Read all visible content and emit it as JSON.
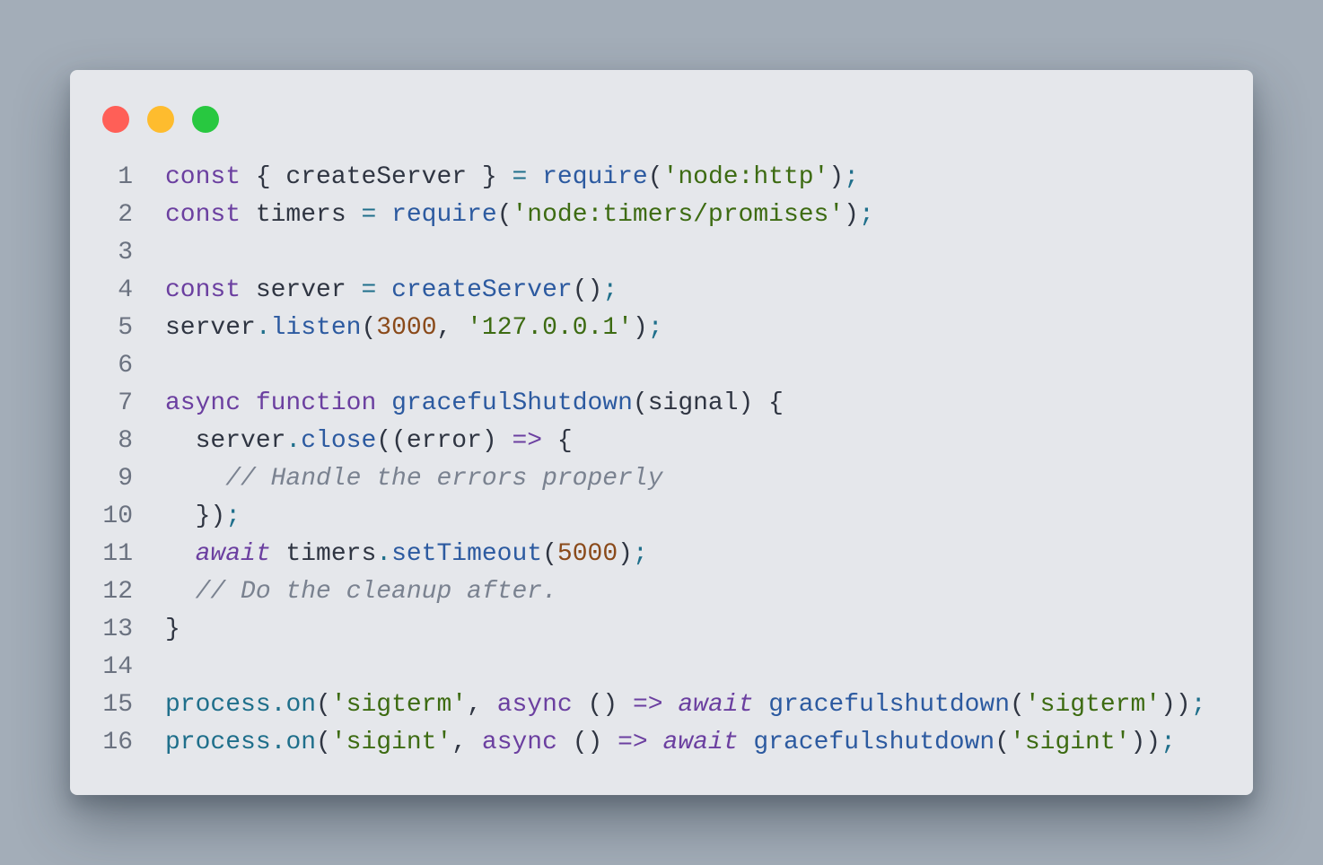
{
  "window": {
    "controls": [
      "close",
      "minimize",
      "maximize"
    ],
    "colors": {
      "close": "#ff5f57",
      "minimize": "#febc2e",
      "maximize": "#28c840",
      "background": "#e5e7eb",
      "page": "#a3adb8"
    }
  },
  "editor": {
    "language": "javascript",
    "lines": [
      {
        "n": "1",
        "tokens": [
          {
            "t": "kw",
            "v": "const"
          },
          {
            "t": "plain",
            "v": " { createServer } "
          },
          {
            "t": "op",
            "v": "="
          },
          {
            "t": "plain",
            "v": " "
          },
          {
            "t": "fn",
            "v": "require"
          },
          {
            "t": "punc",
            "v": "("
          },
          {
            "t": "str",
            "v": "'node:http'"
          },
          {
            "t": "punc",
            "v": ")"
          },
          {
            "t": "op",
            "v": ";"
          }
        ]
      },
      {
        "n": "2",
        "tokens": [
          {
            "t": "kw",
            "v": "const"
          },
          {
            "t": "plain",
            "v": " timers "
          },
          {
            "t": "op",
            "v": "="
          },
          {
            "t": "plain",
            "v": " "
          },
          {
            "t": "fn",
            "v": "require"
          },
          {
            "t": "punc",
            "v": "("
          },
          {
            "t": "str",
            "v": "'node:timers/promises'"
          },
          {
            "t": "punc",
            "v": ")"
          },
          {
            "t": "op",
            "v": ";"
          }
        ]
      },
      {
        "n": "3",
        "tokens": []
      },
      {
        "n": "4",
        "tokens": [
          {
            "t": "kw",
            "v": "const"
          },
          {
            "t": "plain",
            "v": " server "
          },
          {
            "t": "op",
            "v": "="
          },
          {
            "t": "plain",
            "v": " "
          },
          {
            "t": "fn",
            "v": "createServer"
          },
          {
            "t": "punc",
            "v": "()"
          },
          {
            "t": "op",
            "v": ";"
          }
        ]
      },
      {
        "n": "5",
        "tokens": [
          {
            "t": "plain",
            "v": "server"
          },
          {
            "t": "op",
            "v": "."
          },
          {
            "t": "fn",
            "v": "listen"
          },
          {
            "t": "punc",
            "v": "("
          },
          {
            "t": "num",
            "v": "3000"
          },
          {
            "t": "punc",
            "v": ", "
          },
          {
            "t": "str",
            "v": "'127.0.0.1'"
          },
          {
            "t": "punc",
            "v": ")"
          },
          {
            "t": "op",
            "v": ";"
          }
        ]
      },
      {
        "n": "6",
        "tokens": []
      },
      {
        "n": "7",
        "tokens": [
          {
            "t": "kw",
            "v": "async"
          },
          {
            "t": "plain",
            "v": " "
          },
          {
            "t": "kw",
            "v": "function"
          },
          {
            "t": "plain",
            "v": " "
          },
          {
            "t": "fn",
            "v": "gracefulShutdown"
          },
          {
            "t": "punc",
            "v": "(signal) {"
          }
        ]
      },
      {
        "n": "8",
        "tokens": [
          {
            "t": "plain",
            "v": "  server"
          },
          {
            "t": "op",
            "v": "."
          },
          {
            "t": "fn",
            "v": "close"
          },
          {
            "t": "punc",
            "v": "((error) "
          },
          {
            "t": "kw",
            "v": "=>"
          },
          {
            "t": "punc",
            "v": " {"
          }
        ]
      },
      {
        "n": "9",
        "tokens": [
          {
            "t": "cm",
            "v": "    // Handle the errors properly"
          }
        ]
      },
      {
        "n": "10",
        "tokens": [
          {
            "t": "punc",
            "v": "  })"
          },
          {
            "t": "op",
            "v": ";"
          }
        ]
      },
      {
        "n": "11",
        "tokens": [
          {
            "t": "plain",
            "v": "  "
          },
          {
            "t": "kwi",
            "v": "await"
          },
          {
            "t": "plain",
            "v": " timers"
          },
          {
            "t": "op",
            "v": "."
          },
          {
            "t": "fn",
            "v": "setTimeout"
          },
          {
            "t": "punc",
            "v": "("
          },
          {
            "t": "num",
            "v": "5000"
          },
          {
            "t": "punc",
            "v": ")"
          },
          {
            "t": "op",
            "v": ";"
          }
        ]
      },
      {
        "n": "12",
        "tokens": [
          {
            "t": "cm",
            "v": "  // Do the cleanup after."
          }
        ]
      },
      {
        "n": "13",
        "tokens": [
          {
            "t": "punc",
            "v": "}"
          }
        ]
      },
      {
        "n": "14",
        "tokens": []
      },
      {
        "n": "15",
        "tokens": [
          {
            "t": "obj",
            "v": "process"
          },
          {
            "t": "op",
            "v": "."
          },
          {
            "t": "obj",
            "v": "on"
          },
          {
            "t": "punc",
            "v": "("
          },
          {
            "t": "str",
            "v": "'sigterm'"
          },
          {
            "t": "punc",
            "v": ", "
          },
          {
            "t": "kw",
            "v": "async"
          },
          {
            "t": "punc",
            "v": " () "
          },
          {
            "t": "kw",
            "v": "=>"
          },
          {
            "t": "plain",
            "v": " "
          },
          {
            "t": "kwi",
            "v": "await"
          },
          {
            "t": "plain",
            "v": " "
          },
          {
            "t": "fn",
            "v": "gracefulshutdown"
          },
          {
            "t": "punc",
            "v": "("
          },
          {
            "t": "str",
            "v": "'sigterm'"
          },
          {
            "t": "punc",
            "v": "))"
          },
          {
            "t": "op",
            "v": ";"
          }
        ]
      },
      {
        "n": "16",
        "tokens": [
          {
            "t": "obj",
            "v": "process"
          },
          {
            "t": "op",
            "v": "."
          },
          {
            "t": "obj",
            "v": "on"
          },
          {
            "t": "punc",
            "v": "("
          },
          {
            "t": "str",
            "v": "'sigint'"
          },
          {
            "t": "punc",
            "v": ", "
          },
          {
            "t": "kw",
            "v": "async"
          },
          {
            "t": "punc",
            "v": " () "
          },
          {
            "t": "kw",
            "v": "=>"
          },
          {
            "t": "plain",
            "v": " "
          },
          {
            "t": "kwi",
            "v": "await"
          },
          {
            "t": "plain",
            "v": " "
          },
          {
            "t": "fn",
            "v": "gracefulshutdown"
          },
          {
            "t": "punc",
            "v": "("
          },
          {
            "t": "str",
            "v": "'sigint'"
          },
          {
            "t": "punc",
            "v": "))"
          },
          {
            "t": "op",
            "v": ";"
          }
        ]
      }
    ]
  }
}
